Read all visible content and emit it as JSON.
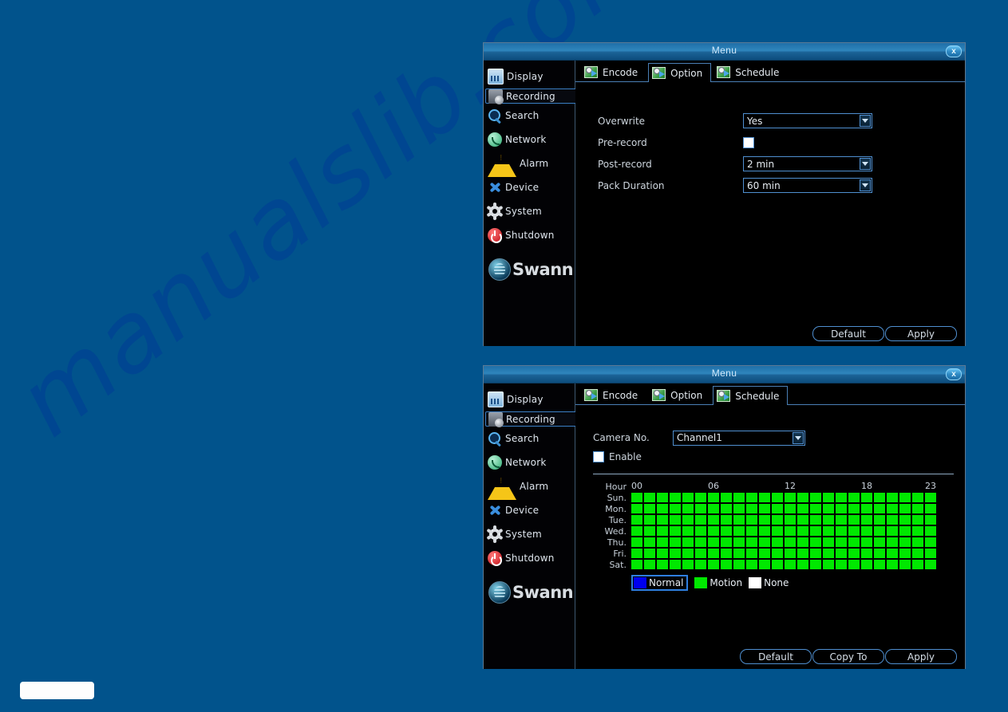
{
  "page": {
    "background_color": "#01538c",
    "watermark_text": "manualslib.com"
  },
  "sidebar": {
    "items": [
      {
        "label": "Display",
        "icon": "display-icon",
        "selected": false
      },
      {
        "label": "Recording",
        "icon": "recording-icon",
        "selected": true
      },
      {
        "label": "Search",
        "icon": "search-icon",
        "selected": false
      },
      {
        "label": "Network",
        "icon": "network-icon",
        "selected": false
      },
      {
        "label": "Alarm",
        "icon": "alarm-icon",
        "selected": false
      },
      {
        "label": "Device",
        "icon": "device-icon",
        "selected": false
      },
      {
        "label": "System",
        "icon": "system-icon",
        "selected": false
      },
      {
        "label": "Shutdown",
        "icon": "shutdown-icon",
        "selected": false
      }
    ],
    "brand": "Swann"
  },
  "window1": {
    "title": "Menu",
    "close_label": "x",
    "tabs": [
      {
        "label": "Encode",
        "active": false
      },
      {
        "label": "Option",
        "active": true
      },
      {
        "label": "Schedule",
        "active": false
      }
    ],
    "fields": [
      {
        "label": "Overwrite",
        "type": "select",
        "value": "Yes"
      },
      {
        "label": "Pre-record",
        "type": "checkbox",
        "value": ""
      },
      {
        "label": "Post-record",
        "type": "select",
        "value": "2 min"
      },
      {
        "label": "Pack Duration",
        "type": "select",
        "value": "60 min"
      }
    ],
    "buttons": [
      {
        "label": "Default"
      },
      {
        "label": "Apply"
      }
    ]
  },
  "window2": {
    "title": "Menu",
    "close_label": "x",
    "tabs": [
      {
        "label": "Encode",
        "active": false
      },
      {
        "label": "Option",
        "active": false
      },
      {
        "label": "Schedule",
        "active": true
      }
    ],
    "camera_label": "Camera No.",
    "camera_value": "Channel1",
    "enable_label": "Enable",
    "hour_label": "Hour",
    "hour_ticks": [
      "00",
      "06",
      "12",
      "18",
      "23"
    ],
    "days": [
      "Sun.",
      "Mon.",
      "Tue.",
      "Wed.",
      "Thu.",
      "Fri.",
      "Sat."
    ],
    "legend": [
      {
        "label": "Normal",
        "color": "#0000ee",
        "selected": true
      },
      {
        "label": "Motion",
        "color": "#00e800",
        "selected": false
      },
      {
        "label": "None",
        "color": "#ffffff",
        "selected": false
      }
    ],
    "buttons": [
      {
        "label": "Default"
      },
      {
        "label": "Copy To"
      },
      {
        "label": "Apply"
      }
    ],
    "schedule_grid": {
      "columns": 24,
      "rows": 7,
      "cell_mode": "Motion",
      "cell_color": "#00e800"
    }
  }
}
